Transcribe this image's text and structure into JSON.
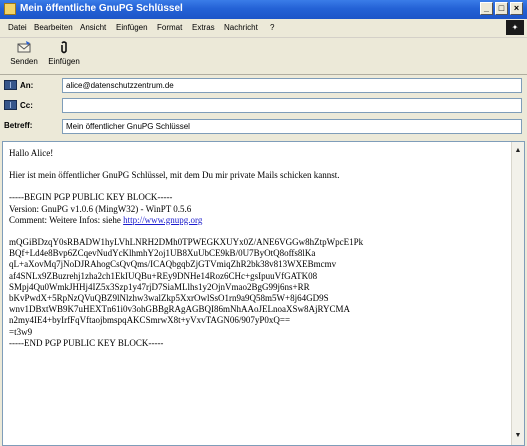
{
  "window": {
    "title": "Mein öffentliche GnuPG Schlüssel"
  },
  "menu": [
    "Datei",
    "Bearbeiten",
    "Ansicht",
    "Einfügen",
    "Format",
    "Extras",
    "Nachricht",
    "?"
  ],
  "toolbar": {
    "send_label": "Senden",
    "attach_label": "Einfügen"
  },
  "header": {
    "to_label": "An:",
    "to_value": "alice@datenschutzzentrum.de",
    "cc_label": "Cc:",
    "cc_value": "",
    "subject_label": "Betreff:",
    "subject_value": "Mein öffentlicher GnuPG Schlüssel"
  },
  "body": {
    "greeting": "Hallo Alice!",
    "intro": "Hier ist mein öffentlicher GnuPG Schlüssel, mit dem Du mir private Mails schicken kannst.",
    "begin": "-----BEGIN PGP PUBLIC KEY BLOCK-----",
    "version": "Version: GnuPG v1.0.6 (MingW32) - WinPT 0.5.6",
    "comment_prefix": "Comment: Weitere Infos: siehe ",
    "comment_link": "http://www.gnupg.org",
    "key_lines": [
      "mQGiBDzqY0sRBADW1hyLVhLNRH2DMh0TPWEGKXUYx0Z/ANE6VGGw8hZtpWpcE1Pk",
      "BQf+Ld4e8Bvp6ZCqevNudYcKlhmhY2oj1UB8XuUbCE9kB/0U7ByOtQ8offs8lKa",
      "qL+aXovMq7jNoDJRAhogCsQvQms/ICAQbgqbZjGTVmiqZhR2bk38v813WXEBmcmv",
      "af4SNLx9ZBuzrehj1zha2ch1EkIUQBu+REy9DNHe14Roz6CHc+gsIpuuVfGATK08",
      "SMpj4Qu0WmkJHHj4IZ5x3Szp1y47rjD7SiaMLlhs1y2OjnVmao2BgG99j6ns+RR",
      "bKvPwdX+5RpNzQVuQBZ9lNlzhw3walZkp5XxrOwlSsO1rn9a9Q58m5W+8j64GD9S",
      "wnv1DBxtWB9K7uHEXTn61i0v3ohGBBgRAgAGBQI86mNhAAoJELnoaXSw8AjRYCMA",
      "n2my4IE4+byIrfFqVftaojbmspqAKCSmrwX8t+yVxvTAGN06/907yP0xQ==",
      "=t3w9"
    ],
    "end": "-----END PGP PUBLIC KEY BLOCK-----"
  },
  "colors": {
    "title_bar": "#2462d6",
    "chrome": "#ece9d8",
    "link": "#1a1acc"
  }
}
